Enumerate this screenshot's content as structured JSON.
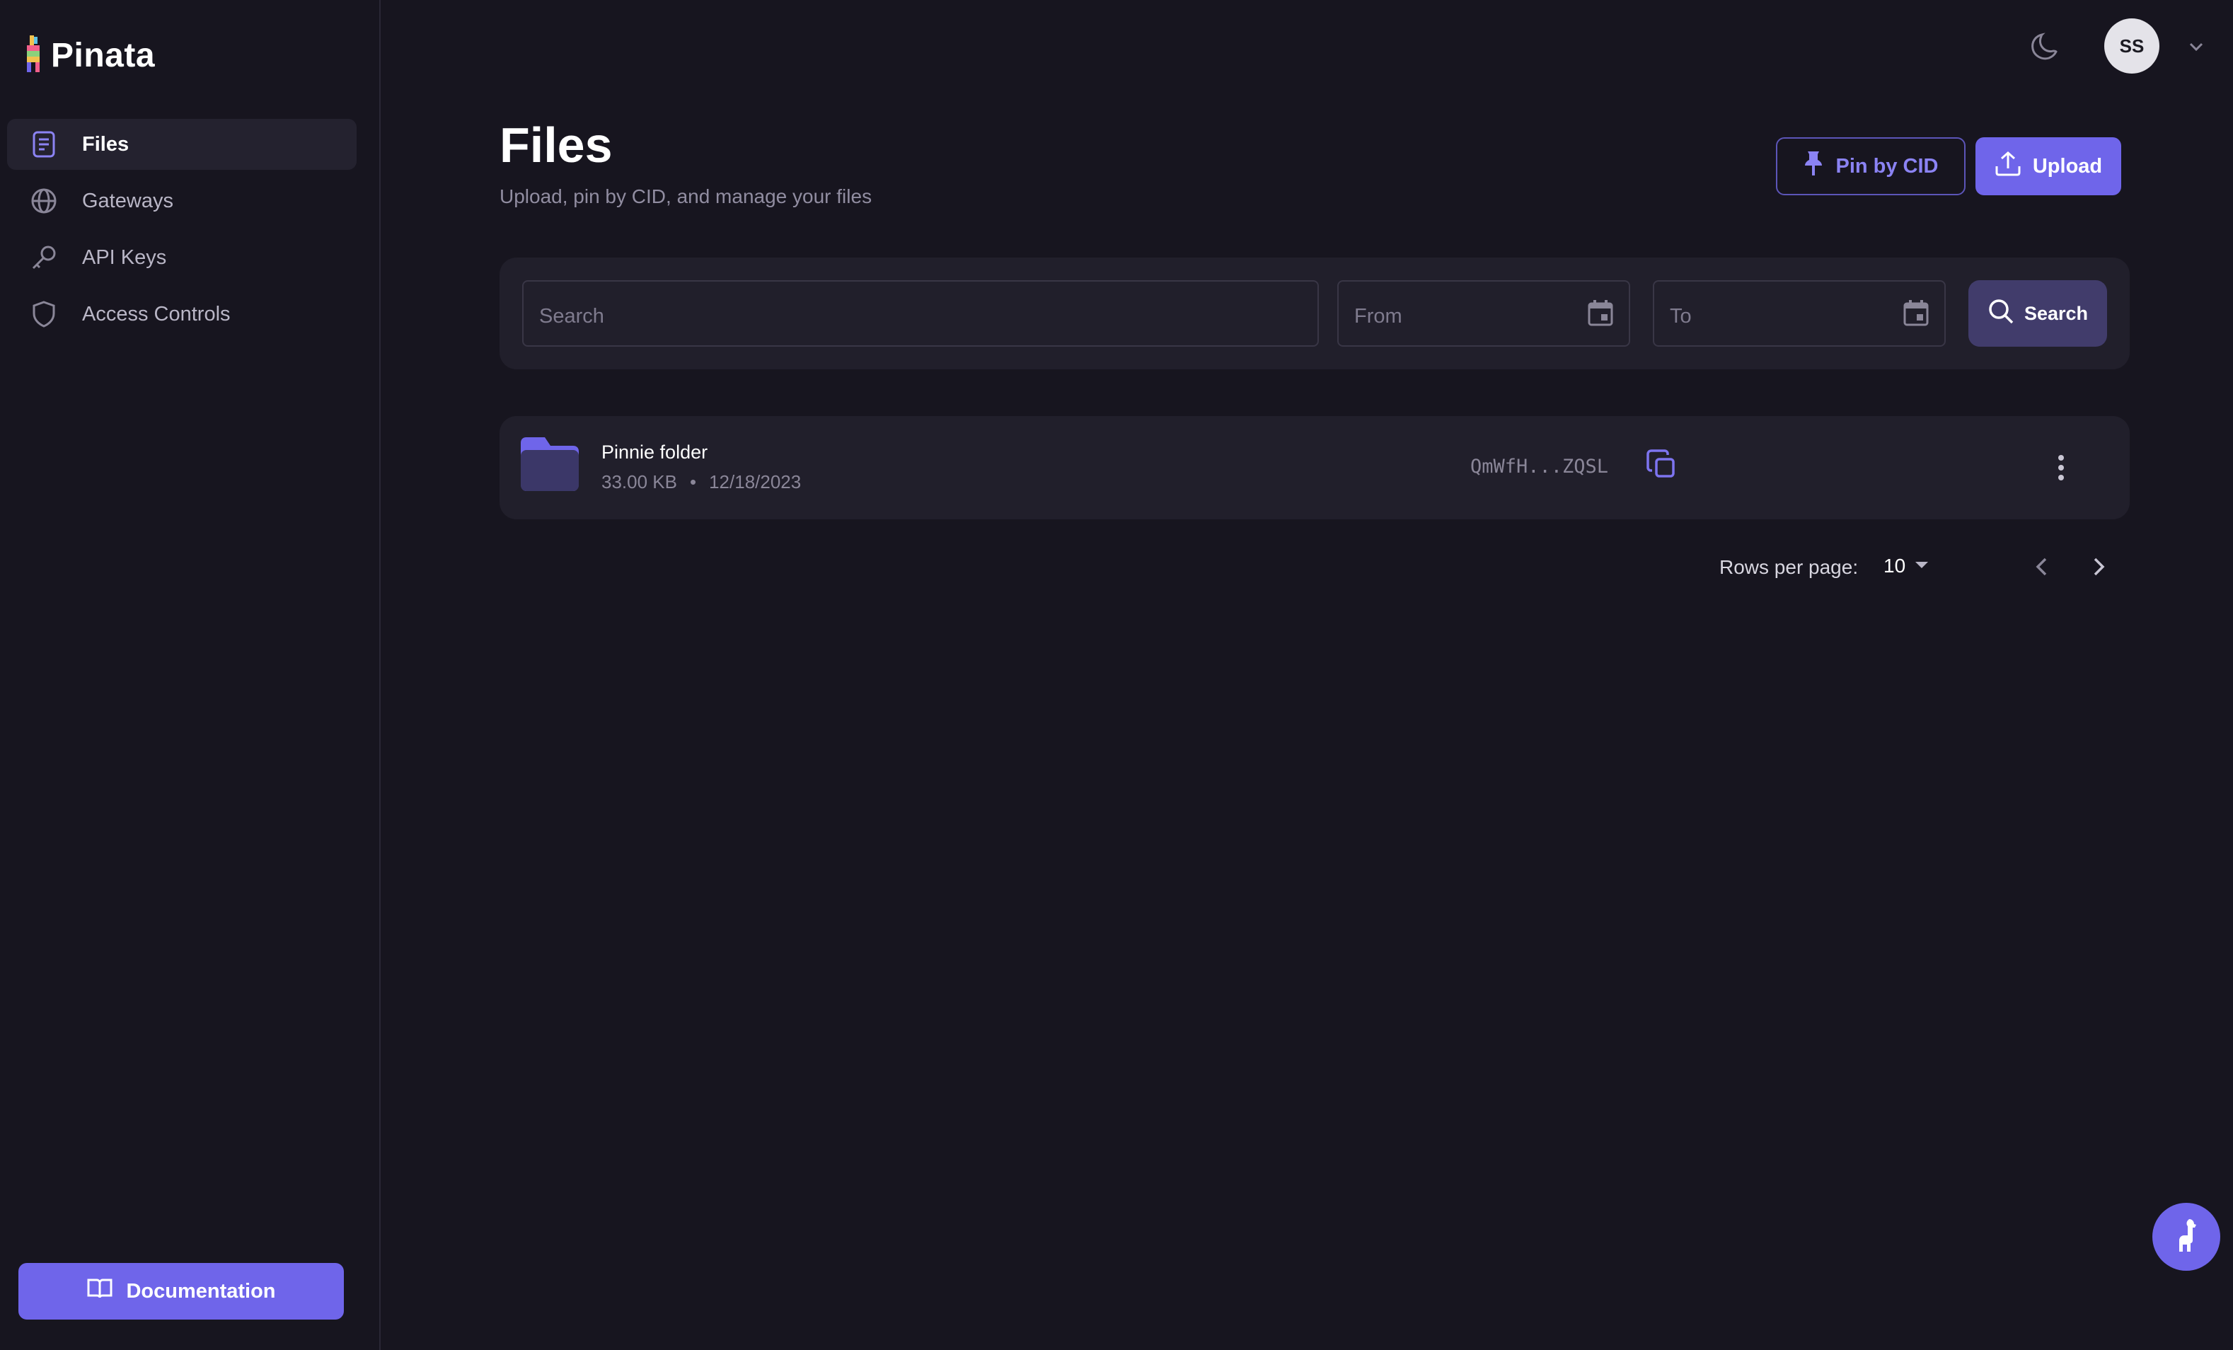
{
  "app": {
    "brand": "Pinata"
  },
  "sidebar": {
    "items": [
      {
        "label": "Files",
        "icon": "file-icon",
        "active": true
      },
      {
        "label": "Gateways",
        "icon": "globe-icon",
        "active": false
      },
      {
        "label": "API Keys",
        "icon": "key-icon",
        "active": false
      },
      {
        "label": "Access Controls",
        "icon": "shield-icon",
        "active": false
      }
    ],
    "documentation_label": "Documentation"
  },
  "topbar": {
    "avatar_initials": "SS",
    "theme_icon": "moon-icon"
  },
  "header": {
    "title": "Files",
    "subtitle": "Upload, pin by CID, and manage your files",
    "pin_label": "Pin by CID",
    "upload_label": "Upload"
  },
  "search": {
    "placeholder": "Search",
    "from_placeholder": "From",
    "to_placeholder": "To",
    "button_label": "Search"
  },
  "files": [
    {
      "name": "Pinnie folder",
      "size": "33.00 KB",
      "separator": "•",
      "date": "12/18/2023",
      "cid": "QmWfH...ZQSL",
      "type": "folder"
    }
  ],
  "pagination": {
    "rows_label": "Rows per page:",
    "rows_value": "10"
  },
  "colors": {
    "background": "#17151f",
    "panel": "#211f2b",
    "accent": "#6f65ea",
    "accent_text": "#8b83f3"
  }
}
